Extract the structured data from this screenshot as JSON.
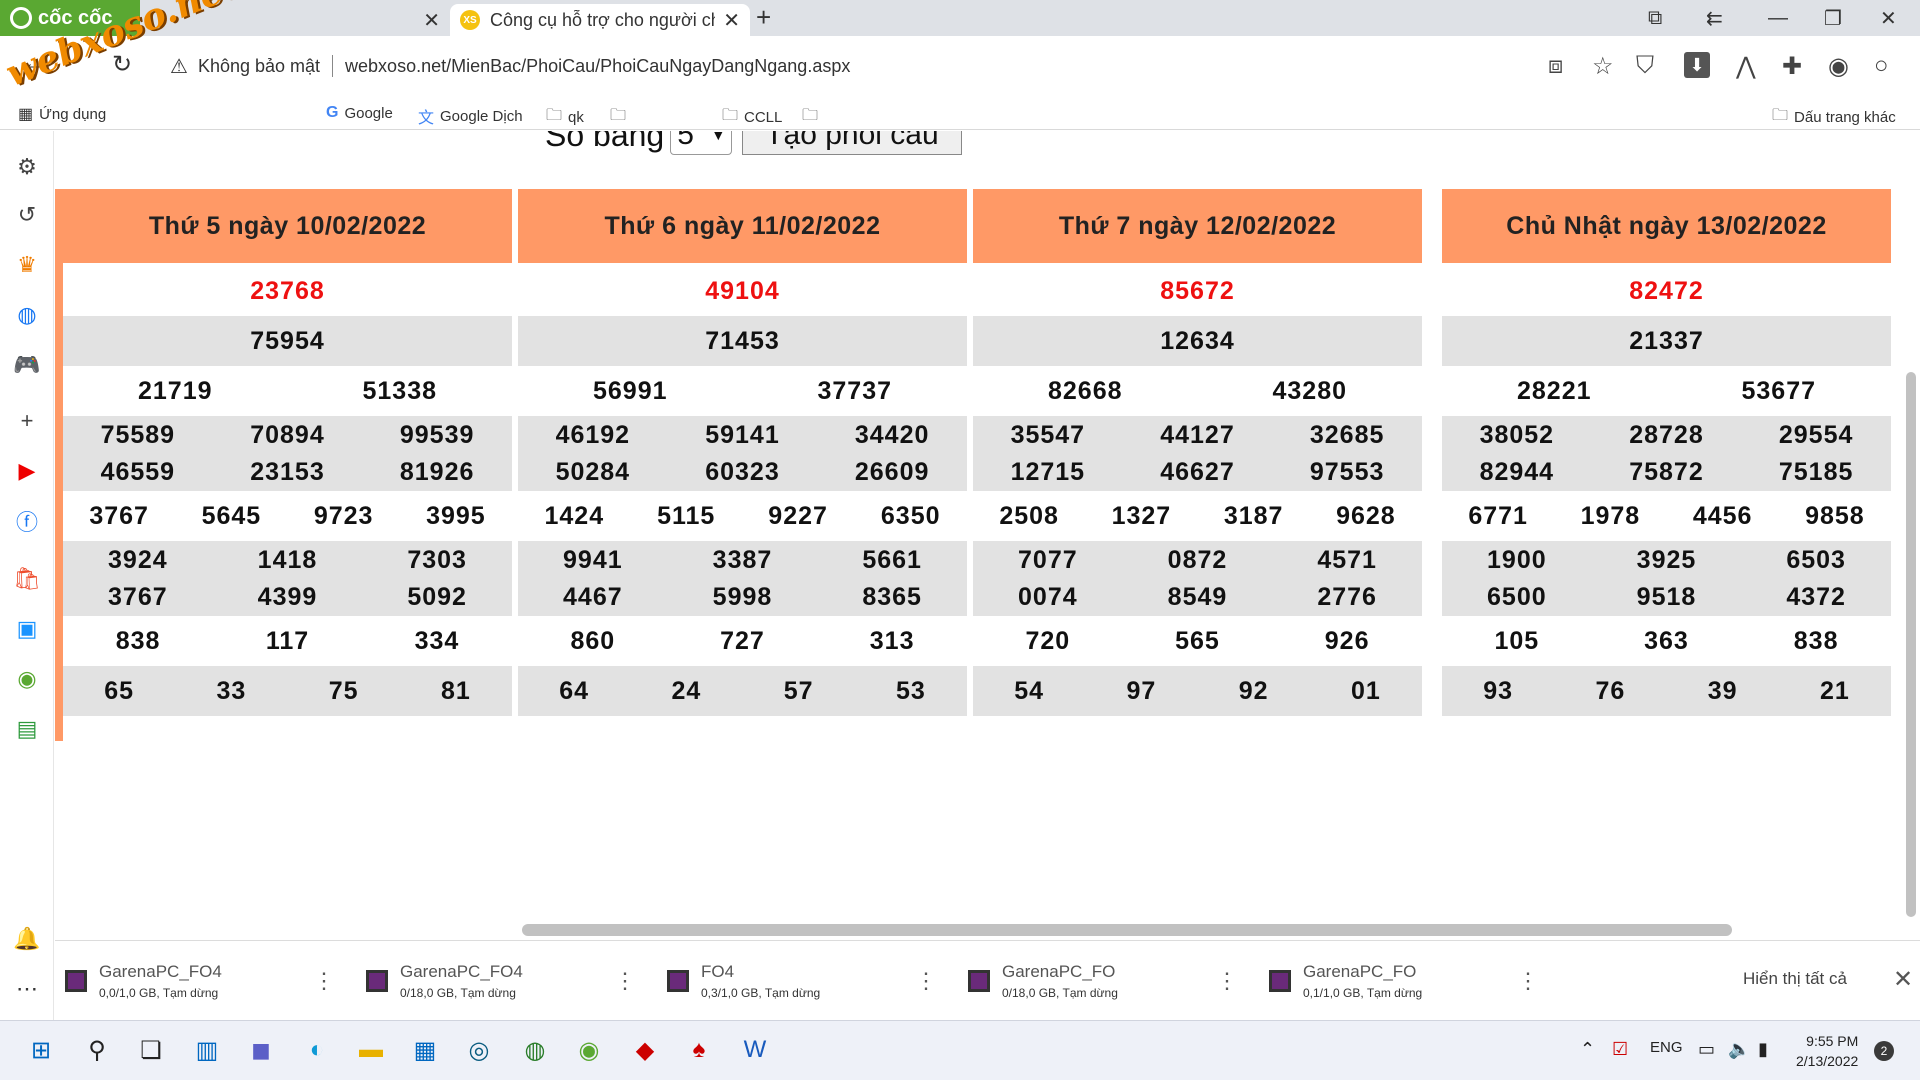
{
  "browser": {
    "brand": "cốc cốc",
    "watermark": "webxoso.net",
    "tabs": [
      {
        "title": "",
        "active": false
      },
      {
        "title": "Công cụ hỗ trợ cho người ch",
        "favicon": "XS",
        "active": true
      }
    ],
    "address": {
      "security": "Không bảo mật",
      "url": "webxoso.net/MienBac/PhoiCau/PhoiCauNgayDangNgang.aspx"
    },
    "bookmarks": [
      {
        "label": "Ứng dụng",
        "icon": "apps-grid-icon"
      },
      {
        "label": "Google",
        "icon": "google-icon"
      },
      {
        "label": "Google Dịch",
        "icon": "translate-icon"
      },
      {
        "label": "qk",
        "icon": "folder-icon"
      },
      {
        "label": "CCLL",
        "icon": "folder-icon"
      }
    ],
    "bookmarks_other": "Dấu trang khác"
  },
  "form": {
    "label": "Số bảng",
    "selected": "5",
    "button": "Tạo phôi cầu"
  },
  "boards": [
    {
      "header": "Thứ 5 ngày 10/02/2022",
      "special": [
        "23768"
      ],
      "first": [
        "75954"
      ],
      "second": [
        "21719",
        "51338"
      ],
      "third": [
        [
          "75589",
          "70894",
          "99539"
        ],
        [
          "46559",
          "23153",
          "81926"
        ]
      ],
      "fourth": [
        "3767",
        "5645",
        "9723",
        "3995"
      ],
      "fifth": [
        [
          "3924",
          "1418",
          "7303"
        ],
        [
          "3767",
          "4399",
          "5092"
        ]
      ],
      "sixth": [
        "838",
        "117",
        "334"
      ],
      "seventh": [
        "65",
        "33",
        "75",
        "81"
      ]
    },
    {
      "header": "Thứ 6 ngày 11/02/2022",
      "special": [
        "49104"
      ],
      "first": [
        "71453"
      ],
      "second": [
        "56991",
        "37737"
      ],
      "third": [
        [
          "46192",
          "59141",
          "34420"
        ],
        [
          "50284",
          "60323",
          "26609"
        ]
      ],
      "fourth": [
        "1424",
        "5115",
        "9227",
        "6350"
      ],
      "fifth": [
        [
          "9941",
          "3387",
          "5661"
        ],
        [
          "4467",
          "5998",
          "8365"
        ]
      ],
      "sixth": [
        "860",
        "727",
        "313"
      ],
      "seventh": [
        "64",
        "24",
        "57",
        "53"
      ]
    },
    {
      "header": "Thứ 7 ngày 12/02/2022",
      "special": [
        "85672"
      ],
      "first": [
        "12634"
      ],
      "second": [
        "82668",
        "43280"
      ],
      "third": [
        [
          "35547",
          "44127",
          "32685"
        ],
        [
          "12715",
          "46627",
          "97553"
        ]
      ],
      "fourth": [
        "2508",
        "1327",
        "3187",
        "9628"
      ],
      "fifth": [
        [
          "7077",
          "0872",
          "4571"
        ],
        [
          "0074",
          "8549",
          "2776"
        ]
      ],
      "sixth": [
        "720",
        "565",
        "926"
      ],
      "seventh": [
        "54",
        "97",
        "92",
        "01"
      ]
    },
    {
      "header": "Chủ Nhật ngày 13/02/2022",
      "special": [
        "82472"
      ],
      "first": [
        "21337"
      ],
      "second": [
        "28221",
        "53677"
      ],
      "third": [
        [
          "38052",
          "28728",
          "29554"
        ],
        [
          "82944",
          "75872",
          "75185"
        ]
      ],
      "fourth": [
        "6771",
        "1978",
        "4456",
        "9858"
      ],
      "fifth": [
        [
          "1900",
          "3925",
          "6503"
        ],
        [
          "6500",
          "9518",
          "4372"
        ]
      ],
      "sixth": [
        "105",
        "363",
        "838"
      ],
      "seventh": [
        "93",
        "76",
        "39",
        "21"
      ]
    }
  ],
  "downloads": [
    {
      "name": "GarenaPC_FO4",
      "status": "0,0/1,0 GB, Tạm dừng"
    },
    {
      "name": "GarenaPC_FO4",
      "status": "0/18,0 GB, Tạm dừng"
    },
    {
      "name": "FO4",
      "status": "0,3/1,0 GB, Tạm dừng"
    },
    {
      "name": "GarenaPC_FO",
      "status": "0/18,0 GB, Tạm dừng"
    },
    {
      "name": "GarenaPC_FO",
      "status": "0,1/1,0 GB, Tạm dừng"
    }
  ],
  "downloads_show_all": "Hiển thị tất cả",
  "taskbar": {
    "lang": "ENG",
    "time": "9:55 PM",
    "date": "2/13/2022",
    "notifications": "2"
  }
}
